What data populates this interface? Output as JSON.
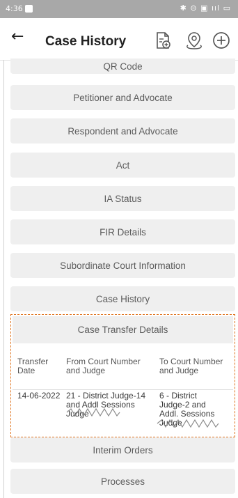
{
  "status_bar": {
    "time": "4:36",
    "icons": "✱ ⊝ ▣ ııl ▭"
  },
  "header": {
    "title": "Case History"
  },
  "sections": [
    "QR Code",
    "Petitioner and Advocate",
    "Respondent and Advocate",
    "Act",
    "IA Status",
    "FIR Details",
    "Subordinate Court Information",
    "Case History"
  ],
  "transfer": {
    "title": "Case Transfer Details",
    "col_date": "Transfer Date",
    "col_from": "From Court Number and Judge",
    "col_to": "To Court Number and Judge",
    "row": {
      "date": "14-06-2022",
      "from": "21 - District Judge-14 and Addl Sessions Judge",
      "to": "6 - District Judge-2 and Addl. Sessions Judge"
    }
  },
  "after_sections": [
    "Interim Orders",
    "Processes"
  ],
  "accent_color": "#e0731e"
}
